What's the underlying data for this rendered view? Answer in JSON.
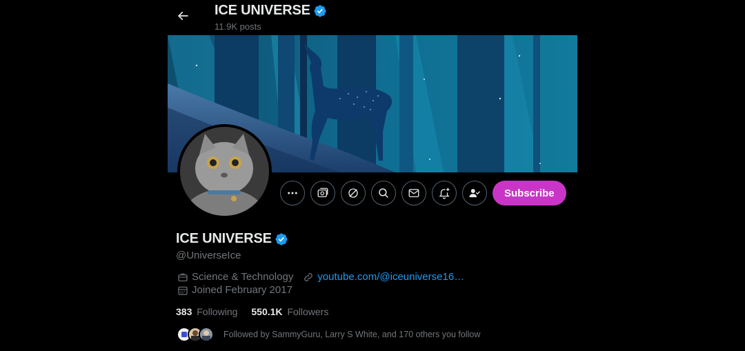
{
  "header": {
    "title": "ICE UNIVERSE",
    "posts_count": "11.9K posts"
  },
  "profile": {
    "display_name": "ICE UNIVERSE",
    "handle": "@UniverseIce",
    "category": "Science & Technology",
    "website": "youtube.com/@iceuniverse16…",
    "joined": "Joined February 2017",
    "following_count": "383",
    "following_label": "Following",
    "followers_count": "550.1K",
    "followers_label": "Followers",
    "followed_by_text": "Followed by SammyGuru, Larry S White, and 170 others you follow"
  },
  "actions": {
    "subscribe_label": "Subscribe"
  },
  "icons": {
    "back": "back-arrow-icon",
    "verified": "verified-badge-icon",
    "more": "more-dots-icon",
    "media": "media-icon",
    "grok": "grok-icon",
    "search": "search-icon",
    "message": "mail-icon",
    "notify": "bell-plus-icon",
    "following": "user-check-icon",
    "category": "briefcase-icon",
    "link": "link-icon",
    "calendar": "calendar-icon"
  },
  "colors": {
    "background": "#000000",
    "text_primary": "#e7e9ea",
    "text_secondary": "#71767b",
    "link": "#1d9bf0",
    "verified": "#1d9bf0",
    "subscribe": "#c936c7"
  }
}
